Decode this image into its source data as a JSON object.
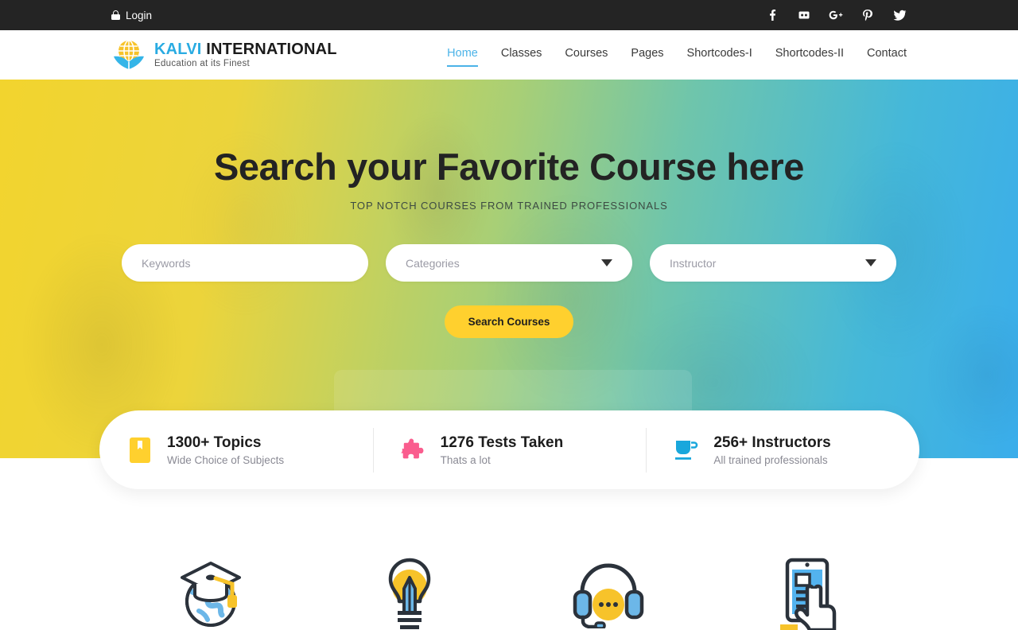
{
  "topbar": {
    "login_label": "Login",
    "login_icon": "lock-icon",
    "socials": [
      {
        "name": "facebook-icon",
        "label": "f"
      },
      {
        "name": "flickr-icon",
        "label": "flickr"
      },
      {
        "name": "google-plus-icon",
        "label": "G+"
      },
      {
        "name": "pinterest-icon",
        "label": "P"
      },
      {
        "name": "twitter-icon",
        "label": "twitter"
      }
    ],
    "background": "#242424"
  },
  "header": {
    "logo": {
      "icon": "globe-book-logo-icon",
      "title_primary": "KALVI",
      "title_secondary": "INTERNATIONAL",
      "tagline": "Education at its Finest",
      "primary_color": "#29ABE2"
    },
    "nav": [
      {
        "label": "Home",
        "active": true
      },
      {
        "label": "Classes",
        "active": false
      },
      {
        "label": "Courses",
        "active": false
      },
      {
        "label": "Pages",
        "active": false
      },
      {
        "label": "Shortcodes-I",
        "active": false
      },
      {
        "label": "Shortcodes-II",
        "active": false
      },
      {
        "label": "Contact",
        "active": false
      }
    ],
    "active_color": "#4BB3E8"
  },
  "hero": {
    "title": "Search your Favorite Course here",
    "subtitle": "TOP NOTCH COURSES FROM TRAINED PROFESSIONALS",
    "gradient_from": "#f2d42e",
    "gradient_to": "#3aadeb",
    "search": {
      "keywords_placeholder": "Keywords",
      "categories_value": "Categories",
      "instructor_value": "Instructor",
      "button_label": "Search Courses",
      "button_color": "#FFD02E"
    }
  },
  "stats": [
    {
      "icon": "bookmark-icon",
      "icon_color": "#FFD02E",
      "number": "1300+ Topics",
      "label": "Wide Choice of Subjects"
    },
    {
      "icon": "puzzle-piece-icon",
      "icon_color": "#FA5D8E",
      "number": "1276 Tests Taken",
      "label": "Thats a lot"
    },
    {
      "icon": "coffee-cup-icon",
      "icon_color": "#19A7DC",
      "number": "256+ Instructors",
      "label": "All trained professionals"
    }
  ],
  "features": [
    {
      "icon": "graduation-globe-icon"
    },
    {
      "icon": "lightbulb-pencil-icon"
    },
    {
      "icon": "headset-support-icon"
    },
    {
      "icon": "tablet-touch-icon"
    }
  ]
}
